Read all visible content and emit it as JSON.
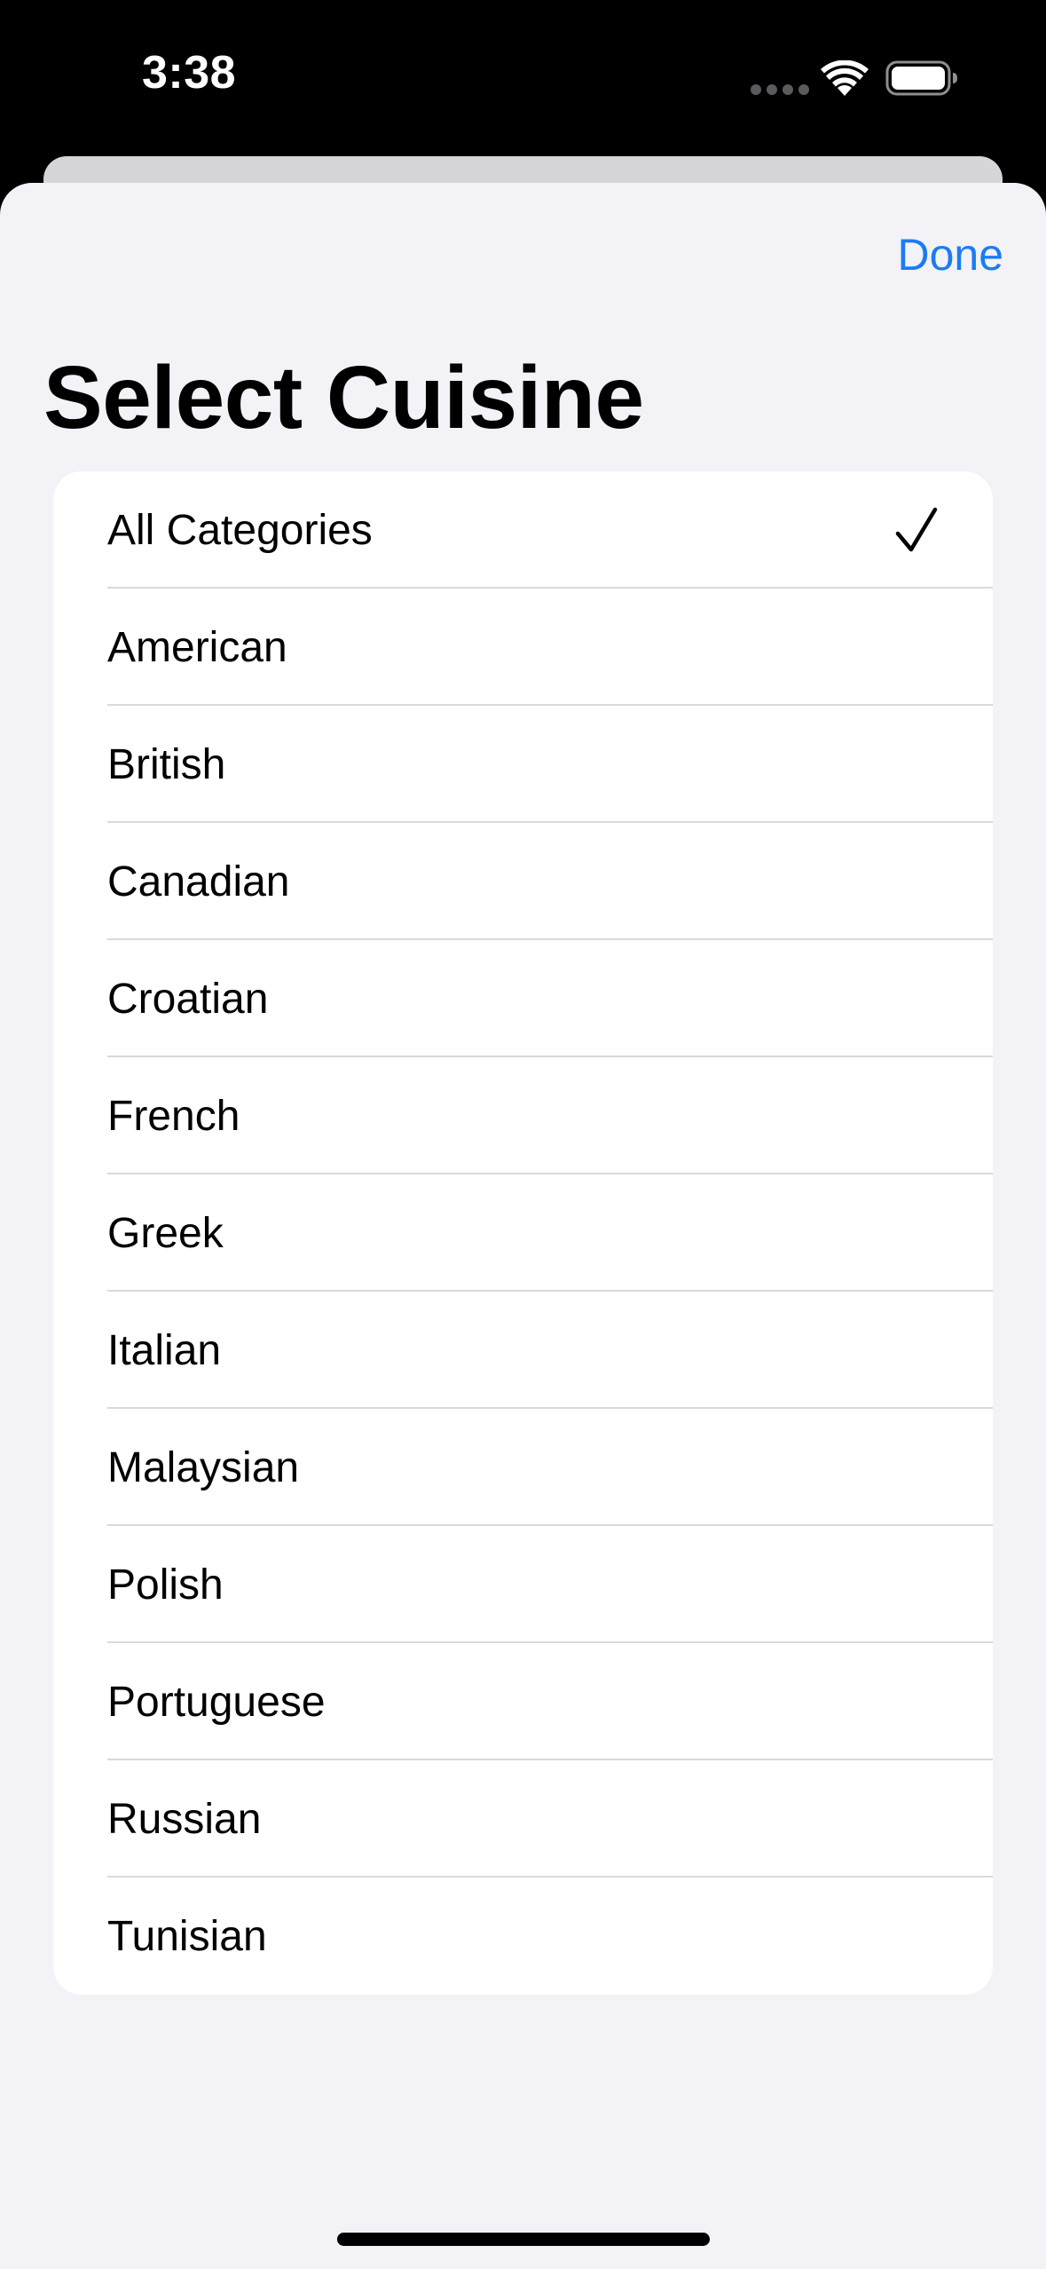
{
  "status_bar": {
    "time": "3:38"
  },
  "navigation": {
    "done_label": "Done",
    "title": "Select Cuisine"
  },
  "cuisine_list": {
    "items": [
      {
        "label": "All Categories",
        "selected": true
      },
      {
        "label": "American",
        "selected": false
      },
      {
        "label": "British",
        "selected": false
      },
      {
        "label": "Canadian",
        "selected": false
      },
      {
        "label": "Croatian",
        "selected": false
      },
      {
        "label": "French",
        "selected": false
      },
      {
        "label": "Greek",
        "selected": false
      },
      {
        "label": "Italian",
        "selected": false
      },
      {
        "label": "Malaysian",
        "selected": false
      },
      {
        "label": "Polish",
        "selected": false
      },
      {
        "label": "Portuguese",
        "selected": false
      },
      {
        "label": "Russian",
        "selected": false
      },
      {
        "label": "Tunisian",
        "selected": false
      }
    ]
  },
  "icons": {
    "wifi": "wifi-icon",
    "battery": "battery-icon",
    "checkmark": "checkmark-icon",
    "signal": "cellular-signal-icon"
  },
  "colors": {
    "accent": "#1a7cf4",
    "sheet_background": "#f2f2f7",
    "card_background": "#ffffff",
    "separator": "#d9d9de"
  }
}
